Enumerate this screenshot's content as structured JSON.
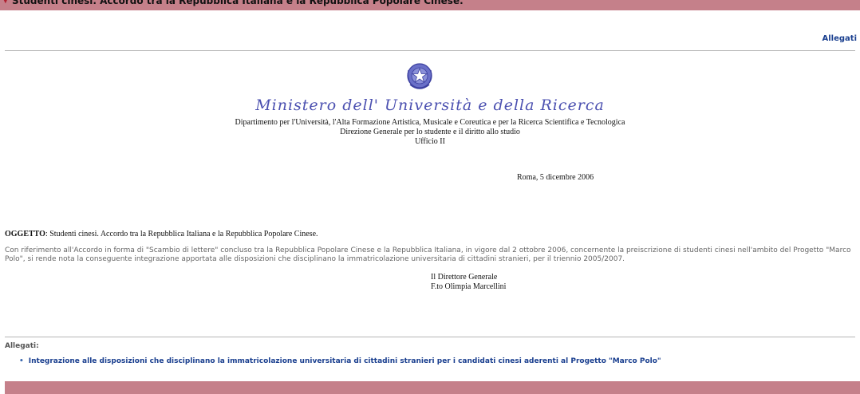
{
  "header": {
    "title": "Studenti cinesi. Accordo tra la Repubblica Italiana e la Repubblica Popolare Cinese."
  },
  "links": {
    "allegati": "Allegati"
  },
  "letterhead": {
    "ministry": "Ministero dell' Università e della Ricerca",
    "department": "Dipartimento per l'Università, l'Alta Formazione Artistica, Musicale e Coreutica e per la Ricerca Scientifica e Tecnologica",
    "direction": "Direzione Generale per lo studente e il diritto allo studio",
    "office": "Ufficio II"
  },
  "date": "Roma, 5 dicembre 2006",
  "subject": {
    "label": "OGGETTO",
    "text": ": Studenti cinesi. Accordo tra la Repubblica Italiana e la Repubblica Popolare Cinese."
  },
  "body": "Con riferimento all'Accordo in forma di \"Scambio di lettere\" concluso tra la Repubblica Popolare Cinese e la Repubblica Italiana, in vigore dal 2 ottobre 2006, concernente la preiscrizione di studenti cinesi nell'ambito del Progetto \"Marco Polo\", si rende nota la conseguente integrazione apportata alle disposizioni che disciplinano la immatricolazione universitaria di cittadini stranieri, per il triennio 2005/2007.",
  "signature": {
    "role": "Il Direttore Generale",
    "name": "F.to Olimpia Marcellini"
  },
  "attachments": {
    "label": "Allegati:",
    "items": [
      "Integrazione alle disposizioni che disciplinano la immatricolazione universitaria di cittadini stranieri per i candidati cinesi aderenti al Progetto \"Marco Polo\""
    ]
  },
  "colors": {
    "bar": "#c5808a",
    "link": "#1a3f8f",
    "ministry": "#4b50b0"
  }
}
